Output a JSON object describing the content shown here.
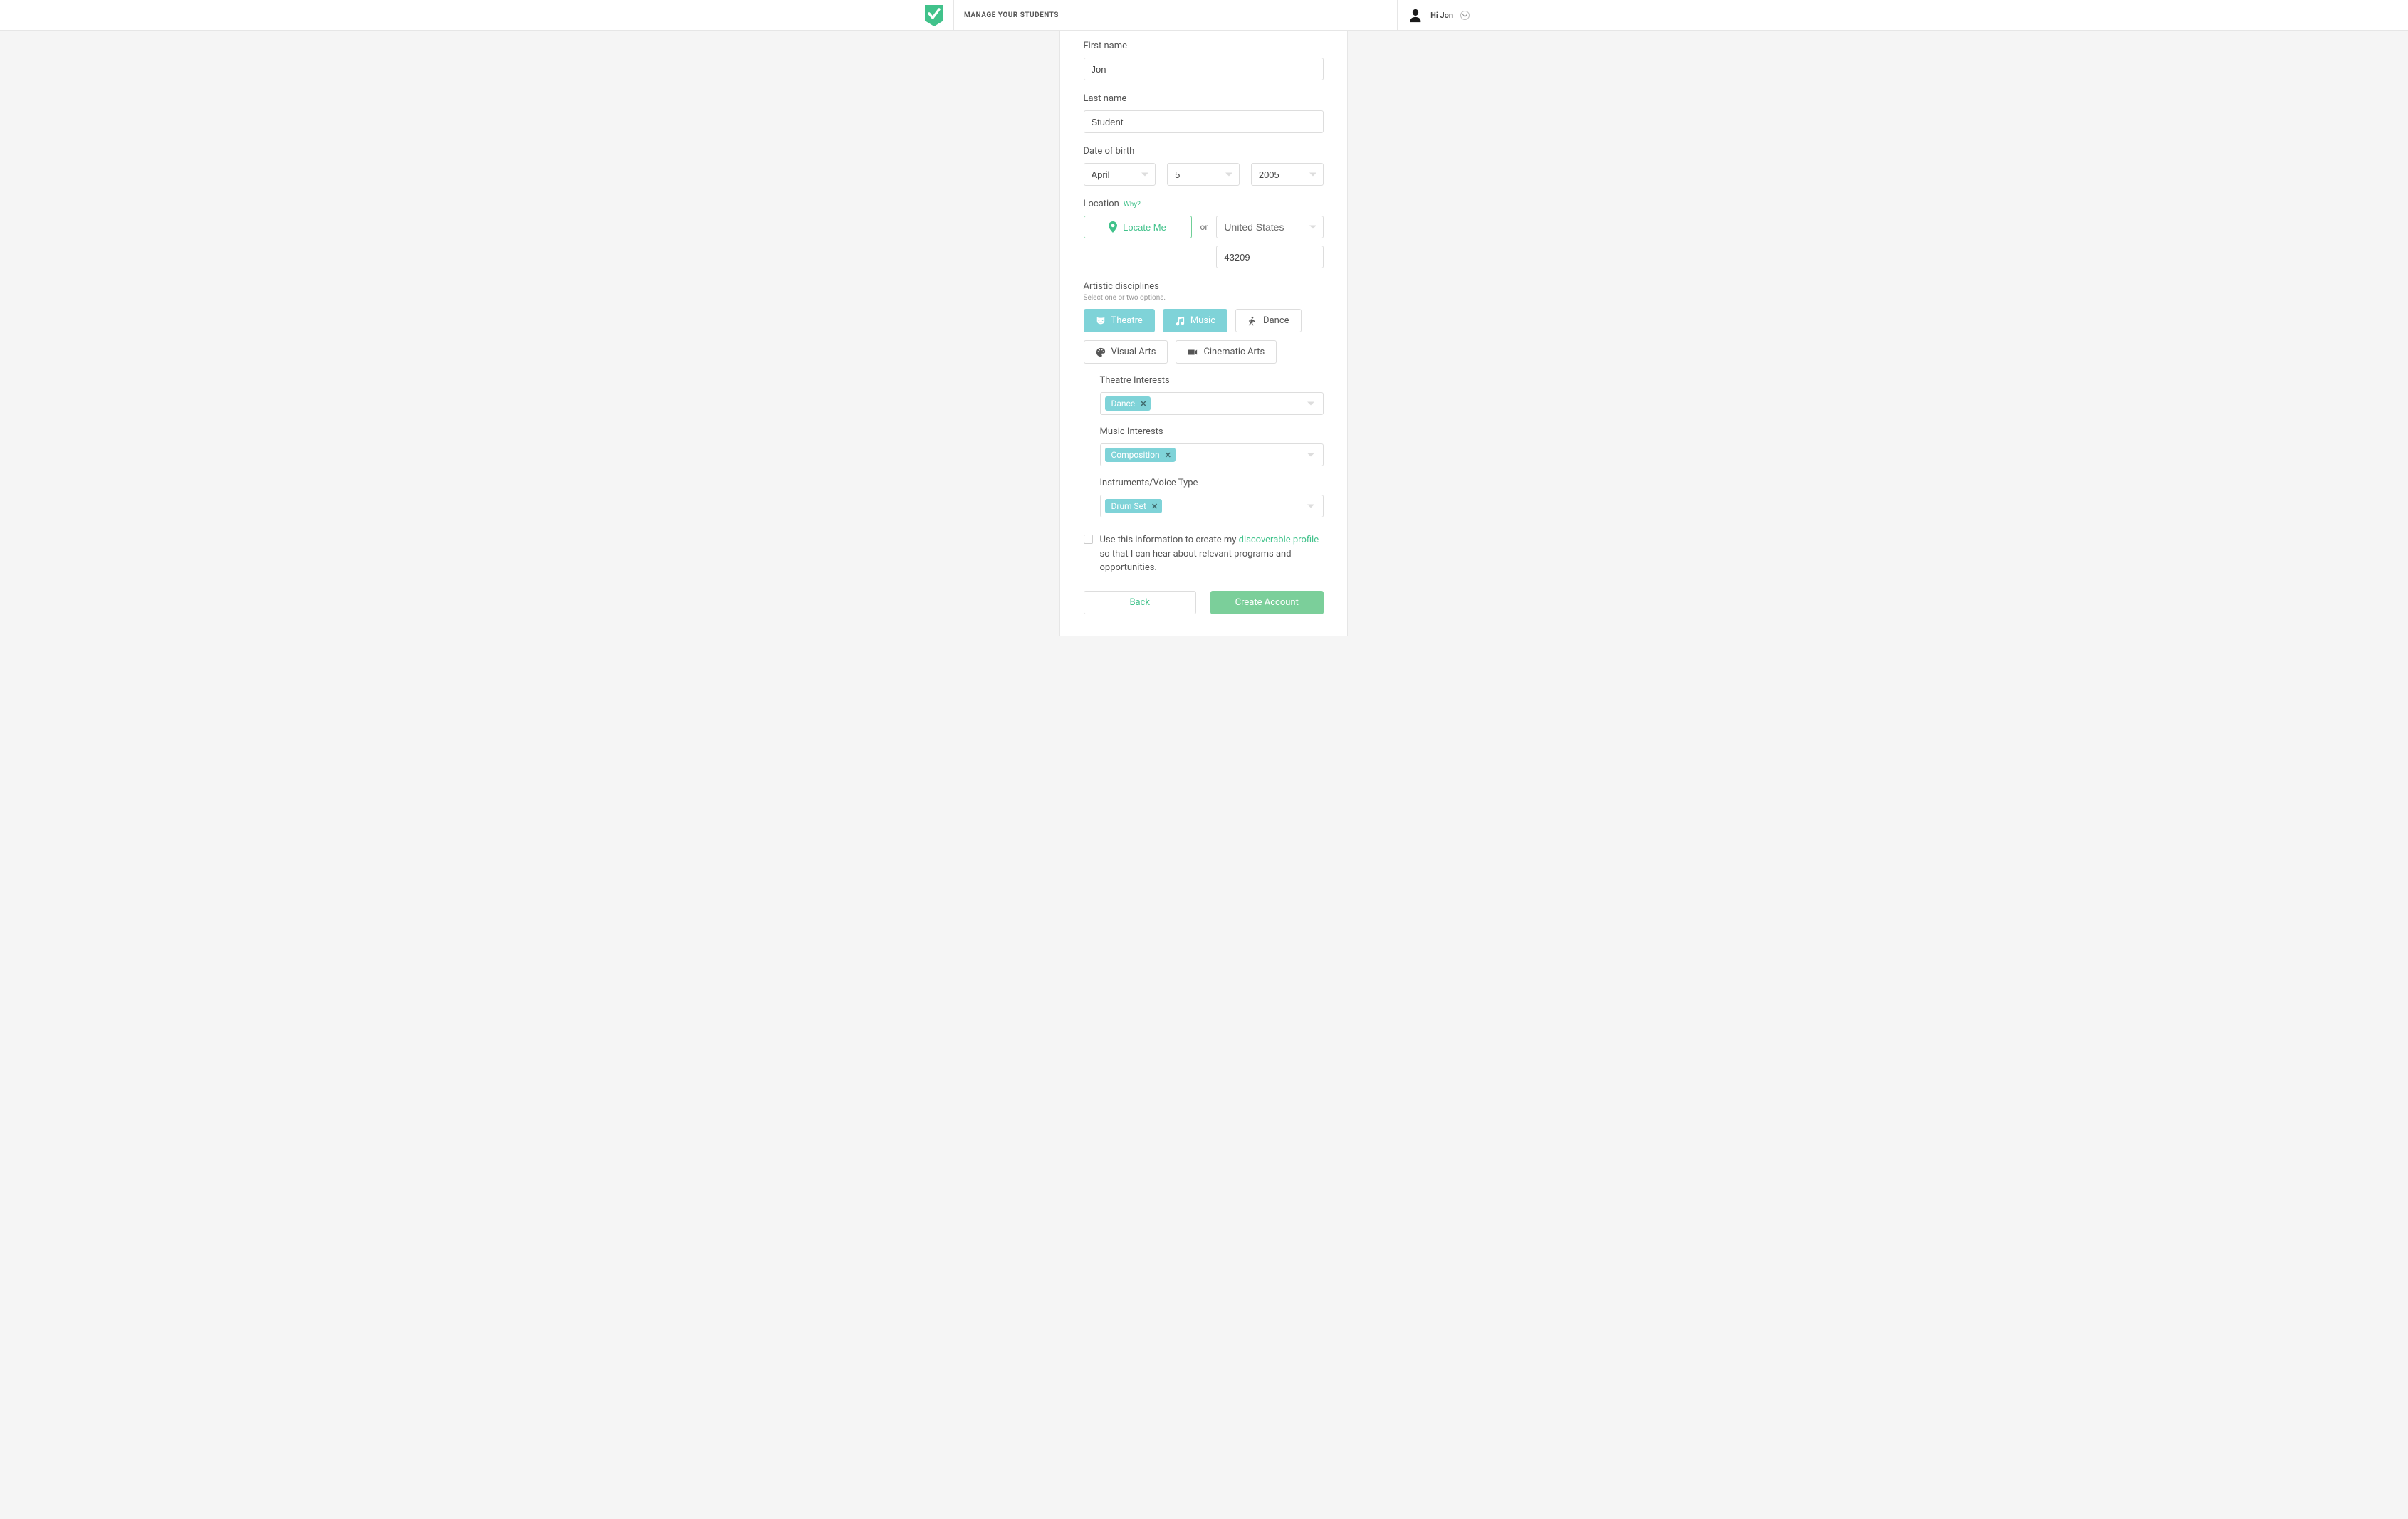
{
  "header": {
    "nav_label": "MANAGE YOUR STUDENTS",
    "user_greeting": "Hi Jon"
  },
  "form": {
    "first_name_label": "First name",
    "first_name_value": "Jon",
    "last_name_label": "Last name",
    "last_name_value": "Student",
    "dob_label": "Date of birth",
    "dob_month": "April",
    "dob_day": "5",
    "dob_year": "2005",
    "location_label": "Location",
    "location_why": "Why?",
    "locate_me": "Locate Me",
    "or_text": "or",
    "country": "United States",
    "postal_code": "43209",
    "disciplines_label": "Artistic disciplines",
    "disciplines_hint": "Select one or two options.",
    "disciplines": {
      "theatre": "Theatre",
      "music": "Music",
      "dance": "Dance",
      "visual_arts": "Visual Arts",
      "cinematic_arts": "Cinematic Arts"
    },
    "theatre_interests_label": "Theatre Interests",
    "theatre_tag": "Dance",
    "music_interests_label": "Music Interests",
    "music_tag": "Composition",
    "instruments_label": "Instruments/Voice Type",
    "instruments_tag": "Drum Set",
    "consent_pre": "Use this information to create my ",
    "consent_link": "discoverable profile",
    "consent_post": " so that I can hear about relevant programs and opportunities.",
    "back_btn": "Back",
    "create_btn": "Create Account"
  }
}
